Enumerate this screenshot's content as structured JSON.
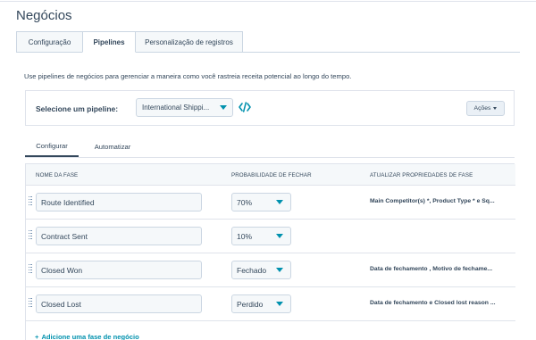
{
  "page": {
    "title": "Negócios"
  },
  "tabs": [
    {
      "label": "Configuração"
    },
    {
      "label": "Pipelines"
    },
    {
      "label": "Personalização de registros"
    }
  ],
  "description": "Use pipelines de negócios para gerenciar a maneira como você rastreia receita potencial ao longo do tempo.",
  "pipeline": {
    "label": "Selecione um pipeline:",
    "selected": "International Shippi...",
    "actions_label": "Ações"
  },
  "subtabs": [
    {
      "label": "Configurar"
    },
    {
      "label": "Automatizar"
    }
  ],
  "table": {
    "headers": {
      "stage": "NOME DA FASE",
      "probability": "PROBABILIDADE DE FECHAR",
      "properties": "ATUALIZAR PROPRIEDADES DE FASE"
    },
    "rows": [
      {
        "name": "Route Identified",
        "probability": "70%",
        "properties": "Main Competitor(s) *, Product Type * e Sq..."
      },
      {
        "name": "Contract Sent",
        "probability": "10%",
        "properties": ""
      },
      {
        "name": "Closed Won",
        "probability": "Fechado",
        "properties": "Data de fechamento , Motivo de fechame..."
      },
      {
        "name": "Closed Lost",
        "probability": "Perdido",
        "properties": "Data de fechamento e Closed lost reason ..."
      }
    ],
    "add_stage_label": "Adicione uma fase de negócio"
  },
  "colors": {
    "accent": "#0091ae",
    "text": "#33475b",
    "border": "#cbd6e2"
  },
  "icons": [
    "drag-handle-icon",
    "code-icon",
    "chevron-down-icon",
    "plus-icon"
  ]
}
